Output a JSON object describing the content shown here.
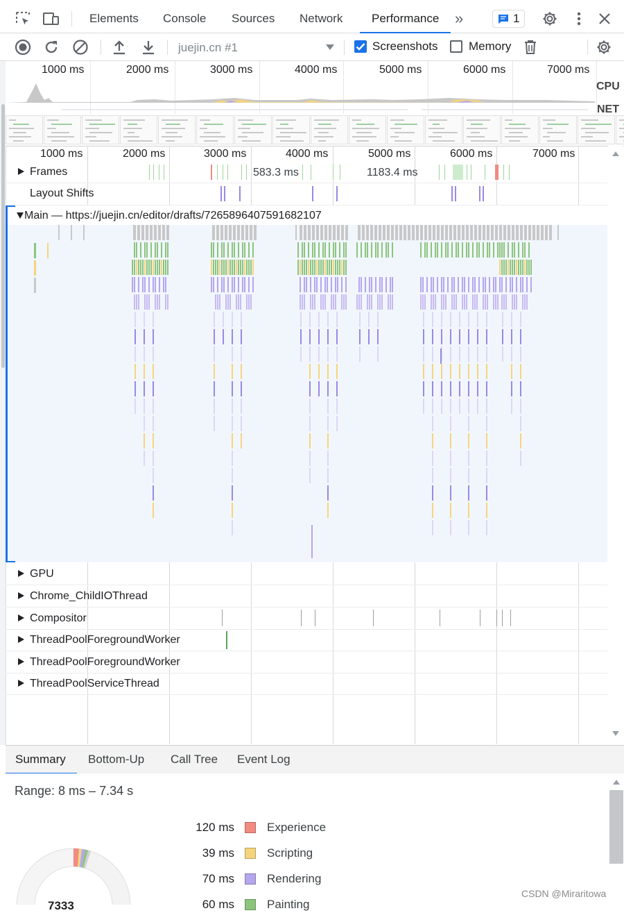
{
  "tabs": {
    "elements": "Elements",
    "console": "Console",
    "sources": "Sources",
    "network": "Network",
    "performance": "Performance",
    "more": "»",
    "issues_count": "1"
  },
  "toolbar": {
    "profile_select": "juejin.cn #1",
    "screenshots_label": "Screenshots",
    "screenshots_checked": true,
    "memory_label": "Memory",
    "memory_checked": false
  },
  "overview": {
    "ticks": [
      "1000 ms",
      "2000 ms",
      "3000 ms",
      "4000 ms",
      "5000 ms",
      "6000 ms",
      "7000 ms"
    ],
    "cpu_label": "CPU",
    "net_label": "NET"
  },
  "timeline": {
    "ticks": [
      "1000 ms",
      "2000 ms",
      "3000 ms",
      "4000 ms",
      "5000 ms",
      "6000 ms",
      "7000 ms"
    ],
    "frames_label": "Frames",
    "frame_time_1": "583.3 ms",
    "frame_time_2": "1183.4 ms",
    "layout_shifts_label": "Layout Shifts",
    "main_label": "Main — https://juejin.cn/editor/drafts/7265896407591682107",
    "tracks": [
      "GPU",
      "Chrome_ChildIOThread",
      "Compositor",
      "ThreadPoolForegroundWorker",
      "ThreadPoolForegroundWorker",
      "ThreadPoolServiceThread"
    ]
  },
  "bottom": {
    "tabs": [
      "Summary",
      "Bottom-Up",
      "Call Tree",
      "Event Log"
    ],
    "range": "Range: 8 ms – 7.34 s",
    "legend": [
      {
        "value": "120 ms",
        "name": "Experience",
        "color": "#f28b82"
      },
      {
        "value": "39 ms",
        "name": "Scripting",
        "color": "#f6d47e"
      },
      {
        "value": "70 ms",
        "name": "Rendering",
        "color": "#b5a6ed"
      },
      {
        "value": "60 ms",
        "name": "Painting",
        "color": "#8cc47d"
      }
    ],
    "donut_total": "7333"
  },
  "watermark": "CSDN @Miraritowa",
  "colors": {
    "accent": "#1a73e8",
    "scripting": "#f6d47e",
    "rendering": "#b5a6ed",
    "painting": "#8cc47d",
    "system": "#c8c8c8",
    "experience": "#f28b82",
    "main_bg": "#f1f6fd"
  }
}
